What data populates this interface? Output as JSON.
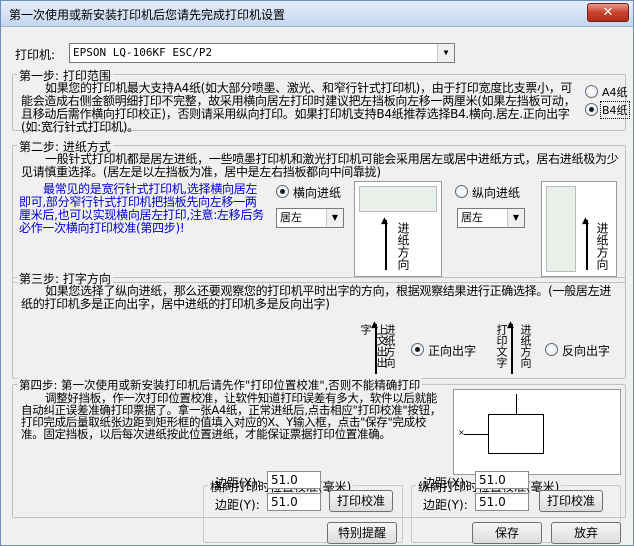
{
  "title": "第一次使用或新安装打印机后您请先完成打印机设置",
  "close_glyph": "✕",
  "printer": {
    "label": "打印机:",
    "selected": "EPSON LQ-106KF ESC/P2"
  },
  "step1": {
    "title": "第一步: 打印范围",
    "text": "如果您的打印机最大支持A4纸(如大部分喷墨、激光、和窄行针式打印机)，由于打印宽度比支票小，可能会造成右侧金额明细打印不完整，故采用横向居左打印时建议把左挡板向左移一两厘米(如果左挡板可动，且移动后需作横向打印校正)，否则请采用纵向打印。如果打印机支持B4纸推荐选择B4.横向.居左.正向出字(如:宽行针式打印机)。",
    "opt_a4": "A4纸",
    "opt_b4": "B4纸"
  },
  "step2": {
    "title": "第二步: 进纸方式",
    "text": "一般针式打印机都是居左进纸，一些喷墨打印机和激光打印机可能会采用居左或居中进纸方式，居右进纸极为少见请慎重选择。(居左是以左挡板为准，居中是左右挡板都向中间靠拢)",
    "note": "最常见的是宽行针式打印机,选择横向居左即可,部分窄行针式打印机把挡板先向左移一两厘米后,也可以实现横向居左打印,注意:左移后务必作一次横向打印校准(第四步)!",
    "opt_horizontal": "横向进纸",
    "opt_vertical": "纵向进纸",
    "h_align": "居左",
    "v_align": "居左",
    "feed_label": "进纸方向"
  },
  "step3": {
    "title": "第三步: 打字方向",
    "text": "如果您选择了纵向进纸，那么还要观察您的打印机平时出字的方向，根据观察结果进行正确选择。(一般居左进纸的打印机多是正向出字，居中进纸的打印机多是反向出字)",
    "img1_left": "上文出出字",
    "img1_right": "进纸方向",
    "img2_left": "打印文字",
    "img2_right": "进纸方向",
    "opt_forward": "正向出字",
    "opt_reverse": "反向出字"
  },
  "step4": {
    "title": "第四步: 第一次使用或新安装打印机后请先作\"打印位置校准\",否则不能精确打印",
    "text": "调整好挡板，作一次打印位置校准，让软件知道打印误差有多大，软件以后就能自动纠正误差准确打印票据了。拿一张A4纸，正常进纸后,点击相应\"打印校准\"按钮，打印完成后量取纸张边距到矩形框的值填入对应的X、Y输入框，点击\"保存\"完成校准。固定挡板，以后每次进纸按此位置进纸，才能保证票据打印位置准确。",
    "h_group": "横向打印时位置校准(毫米)",
    "v_group": "纵向打印时位置校准(毫米)",
    "margin_x": "边距(X):",
    "margin_y": "边距(Y):",
    "h_x": "51.0",
    "h_y": "51.0",
    "v_x": "51.0",
    "v_y": "51.0",
    "print_cal": "打印校准"
  },
  "buttons": {
    "special": "特别提醒",
    "save": "保存",
    "discard": "放弃"
  }
}
